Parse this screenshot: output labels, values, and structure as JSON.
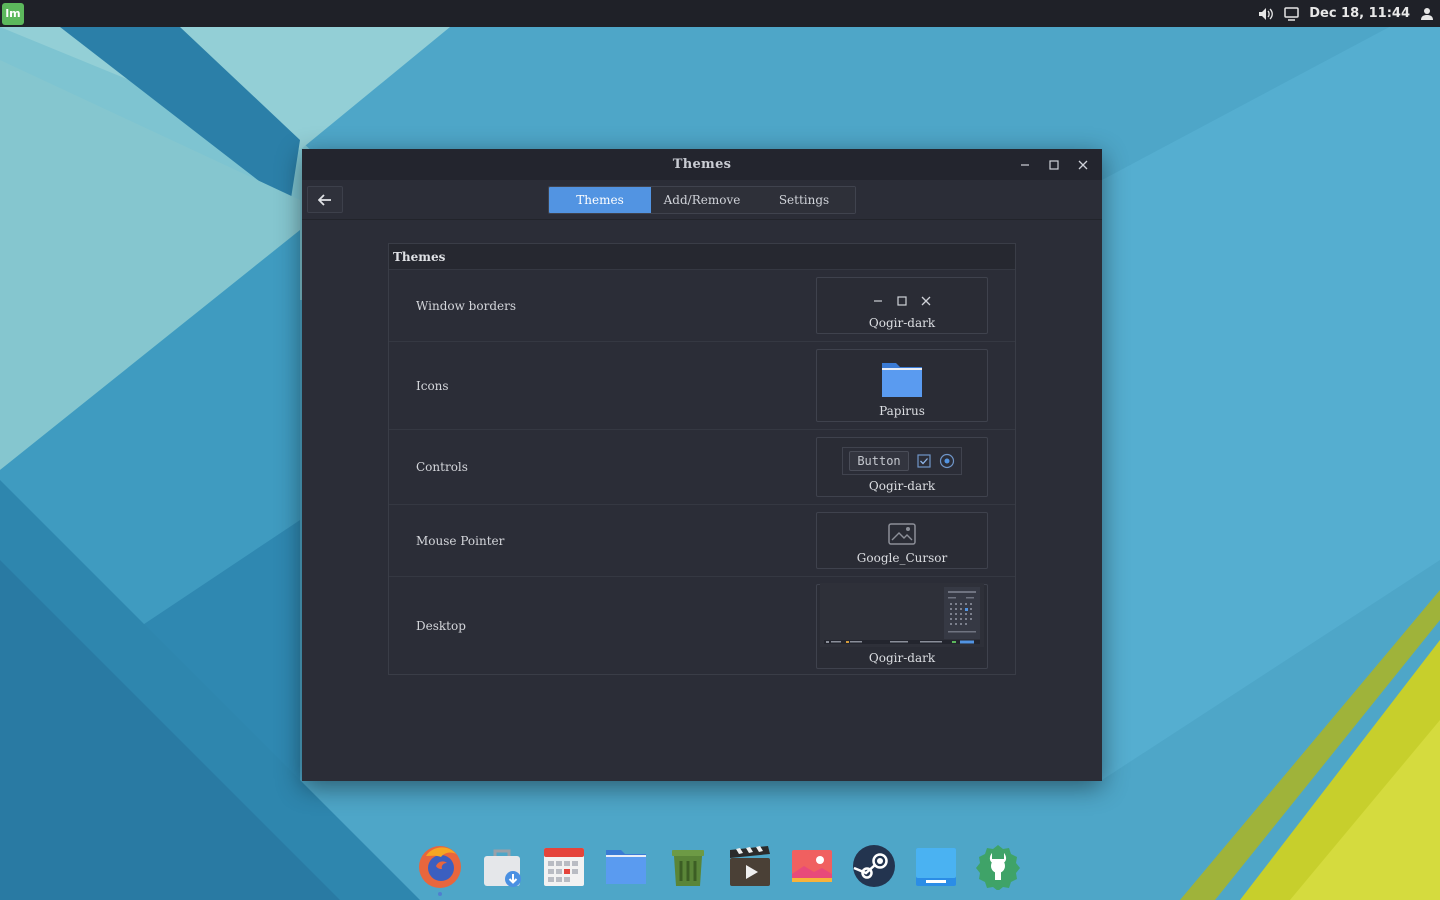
{
  "panel": {
    "menu_logo": "lm",
    "clock": "Dec 18, 11:44",
    "tray_icons": [
      "volume-icon",
      "display-icon",
      "user-icon"
    ]
  },
  "window": {
    "title": "Themes",
    "tabs": [
      {
        "label": "Themes",
        "active": true
      },
      {
        "label": "Add/Remove",
        "active": false
      },
      {
        "label": "Settings",
        "active": false
      }
    ],
    "section_title": "Themes",
    "rows": [
      {
        "label": "Window borders",
        "value": "Qogir-dark"
      },
      {
        "label": "Icons",
        "value": "Papirus"
      },
      {
        "label": "Controls",
        "value": "Qogir-dark",
        "preview_button": "Button"
      },
      {
        "label": "Mouse Pointer",
        "value": "Google_Cursor"
      },
      {
        "label": "Desktop",
        "value": "Qogir-dark"
      }
    ]
  },
  "dock": {
    "items": [
      "firefox-icon",
      "software-manager-icon",
      "calendar-icon",
      "files-icon",
      "trash-icon",
      "video-player-icon",
      "image-viewer-icon",
      "steam-icon",
      "desktop-icon",
      "system-settings-icon"
    ]
  },
  "colors": {
    "accent": "#5294e2",
    "window_bg": "#2b2d37",
    "panel_bg": "#1f2128"
  }
}
